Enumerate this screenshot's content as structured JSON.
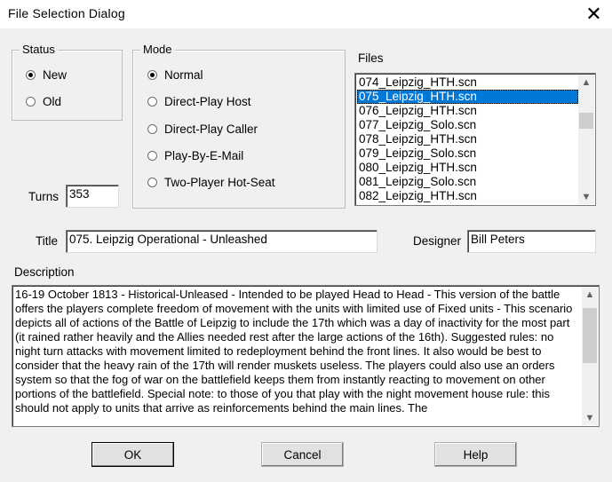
{
  "window": {
    "title": "File Selection Dialog",
    "close_glyph": "✕"
  },
  "status": {
    "legend": "Status",
    "options": [
      {
        "label": "New",
        "checked": true
      },
      {
        "label": "Old",
        "checked": false
      }
    ]
  },
  "mode": {
    "legend": "Mode",
    "options": [
      {
        "label": "Normal",
        "checked": true
      },
      {
        "label": "Direct-Play Host",
        "checked": false
      },
      {
        "label": "Direct-Play Caller",
        "checked": false
      },
      {
        "label": "Play-By-E-Mail",
        "checked": false
      },
      {
        "label": "Two-Player Hot-Seat",
        "checked": false
      }
    ]
  },
  "turns": {
    "label": "Turns",
    "value": "353"
  },
  "files": {
    "label": "Files",
    "items": [
      "074_Leipzig_HTH.scn",
      "075_Leipzig_HTH.scn",
      "076_Leipzig_HTH.scn",
      "077_Leipzig_Solo.scn",
      "078_Leipzig_HTH.scn",
      "079_Leipzig_Solo.scn",
      "080_Leipzig_HTH.scn",
      "081_Leipzig_Solo.scn",
      "082_Leipzig_HTH.scn"
    ],
    "selected": "075_Leipzig_HTH.scn",
    "scroll_up": "▲",
    "scroll_down": "▼"
  },
  "title_field": {
    "label": "Title",
    "value": "075. Leipzig Operational - Unleashed"
  },
  "designer": {
    "label": "Designer",
    "value": "Bill Peters"
  },
  "description": {
    "label": "Description",
    "text": "16-19 October 1813 - Historical-Unleased - Intended to be played Head to Head - This version of the battle offers the players complete freedom of movement with the units with limited use of Fixed units - This scenario depicts all of actions of the Battle of Leipzig to include the 17th which was a day of inactivity for the most part (it rained rather heavily and the Allies needed rest after the large actions of the 16th). Suggested rules: no night turn attacks with movement limited to redeployment behind the front lines. It also would be best to consider that the heavy rain of the 17th will render muskets useless. The players could also use an orders system so that the fog of war on the battlefield keeps them from instantly reacting to movement on other portions of the battlefield. Special note: to those of you that play with the night movement house rule: this should not apply to units that arrive as reinforcements behind the main lines. The",
    "scroll_up": "▲",
    "scroll_down": "▼"
  },
  "buttons": {
    "ok": "OK",
    "cancel": "Cancel",
    "help": "Help"
  }
}
